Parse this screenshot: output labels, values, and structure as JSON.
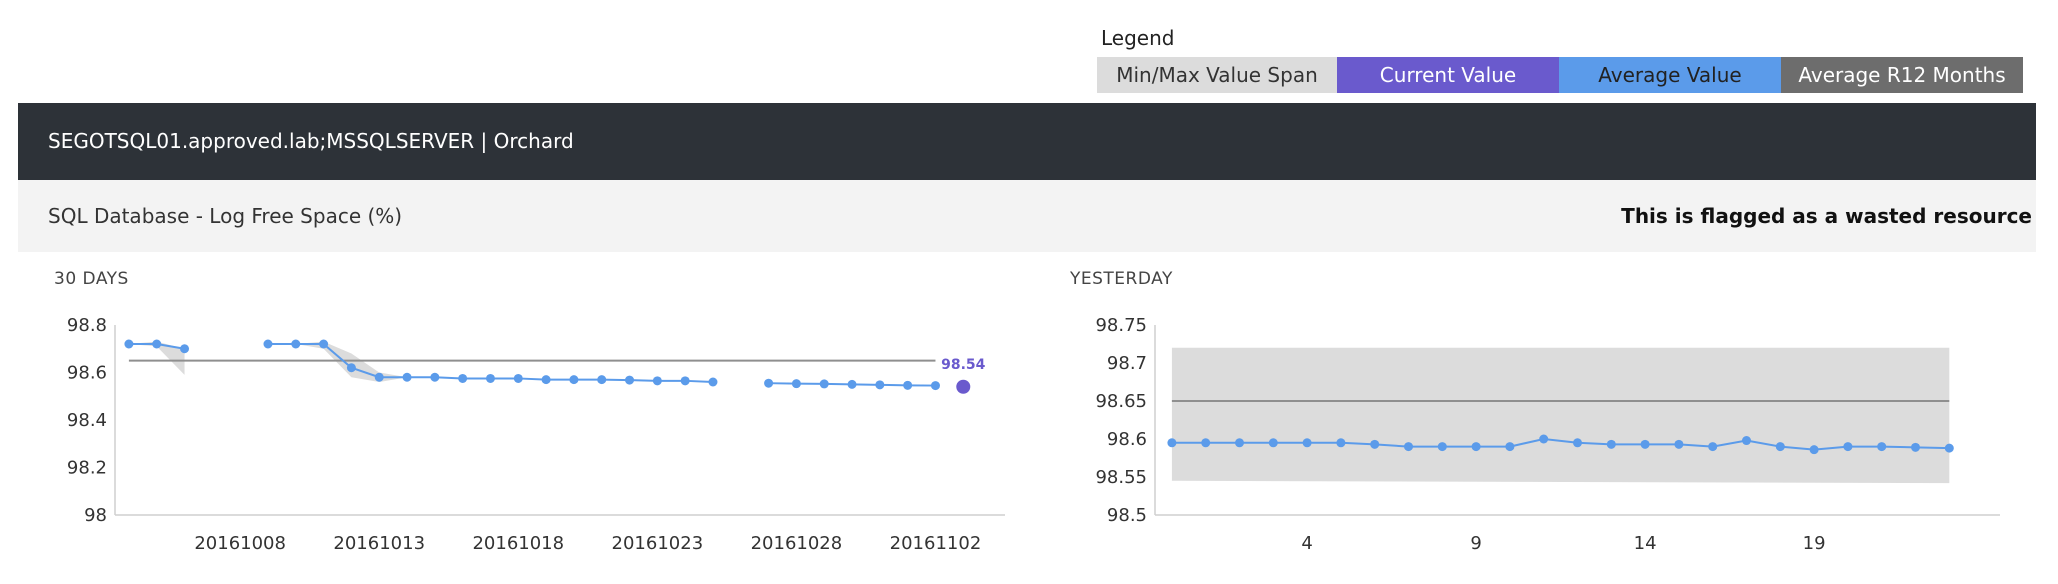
{
  "legend": {
    "title": "Legend",
    "items": [
      "Min/Max Value Span",
      "Current Value",
      "Average Value",
      "Average R12 Months"
    ],
    "colors": {
      "span": "#dcdcdc",
      "current": "#6a5acd",
      "average": "#5b9bea",
      "r12": "#6d6d6d"
    }
  },
  "server": {
    "title": "SEGOTSQL01.approved.lab;MSSQLSERVER | Orchard"
  },
  "metric": {
    "name": "SQL Database - Log Free Space (%)",
    "flag": "This is flagged as a wasted resource"
  },
  "chart_data": [
    {
      "type": "line",
      "title": "30 DAYS",
      "ylim": [
        98,
        98.8
      ],
      "yticks": [
        "98",
        "98.2",
        "98.4",
        "98.6",
        "98.8"
      ],
      "xticks": [
        {
          "x": 5,
          "label": "20161008"
        },
        {
          "x": 10,
          "label": "20161013"
        },
        {
          "x": 15,
          "label": "20161018"
        },
        {
          "x": 20,
          "label": "20161023"
        },
        {
          "x": 25,
          "label": "20161028"
        },
        {
          "x": 30,
          "label": "20161102"
        }
      ],
      "xlim": [
        0.5,
        32.5
      ],
      "average_r12": 98.65,
      "current": {
        "x": 31,
        "value": 98.54,
        "label": "98.54"
      },
      "series": [
        {
          "x": [
            1,
            2,
            3,
            6,
            7,
            8,
            9,
            10,
            11,
            12,
            13,
            14,
            15,
            16,
            17,
            18,
            19,
            20,
            21,
            22,
            24,
            25,
            26,
            27,
            28,
            29,
            30
          ],
          "values": [
            98.72,
            98.72,
            98.7,
            98.72,
            98.72,
            98.72,
            98.62,
            98.58,
            98.58,
            98.58,
            98.575,
            98.575,
            98.575,
            98.57,
            98.57,
            98.57,
            98.568,
            98.565,
            98.565,
            98.56,
            98.555,
            98.553,
            98.552,
            98.55,
            98.548,
            98.546,
            98.545
          ]
        }
      ],
      "span": [
        {
          "x": [
            1,
            2,
            3
          ],
          "min": [
            98.72,
            98.71,
            98.59
          ],
          "max": [
            98.72,
            98.73,
            98.7
          ]
        },
        {
          "x": [
            6,
            7,
            8,
            9,
            10,
            11
          ],
          "min": [
            98.72,
            98.72,
            98.7,
            98.58,
            98.56,
            98.58
          ],
          "max": [
            98.72,
            98.72,
            98.73,
            98.68,
            98.6,
            98.58
          ]
        }
      ]
    },
    {
      "type": "line",
      "title": "YESTERDAY",
      "ylim": [
        98.5,
        98.75
      ],
      "yticks": [
        "98.5",
        "98.55",
        "98.6",
        "98.65",
        "98.7",
        "98.75"
      ],
      "xticks": [
        {
          "x": 4,
          "label": "4"
        },
        {
          "x": 9,
          "label": "9"
        },
        {
          "x": 14,
          "label": "14"
        },
        {
          "x": 19,
          "label": "19"
        }
      ],
      "xlim": [
        -0.5,
        24.5
      ],
      "average_r12": 98.65,
      "series": [
        {
          "x": [
            0,
            1,
            2,
            3,
            4,
            5,
            6,
            7,
            8,
            9,
            10,
            11,
            12,
            13,
            14,
            15,
            16,
            17,
            18,
            19,
            20,
            21,
            22,
            23
          ],
          "values": [
            98.595,
            98.595,
            98.595,
            98.595,
            98.595,
            98.595,
            98.593,
            98.59,
            98.59,
            98.59,
            98.59,
            98.6,
            98.595,
            98.593,
            98.593,
            98.593,
            98.59,
            98.598,
            98.59,
            98.586,
            98.59,
            98.59,
            98.589,
            98.588
          ]
        }
      ],
      "span": [
        {
          "x": [
            0,
            23
          ],
          "min": [
            98.545,
            98.542
          ],
          "max": [
            98.72,
            98.72
          ]
        }
      ]
    }
  ]
}
